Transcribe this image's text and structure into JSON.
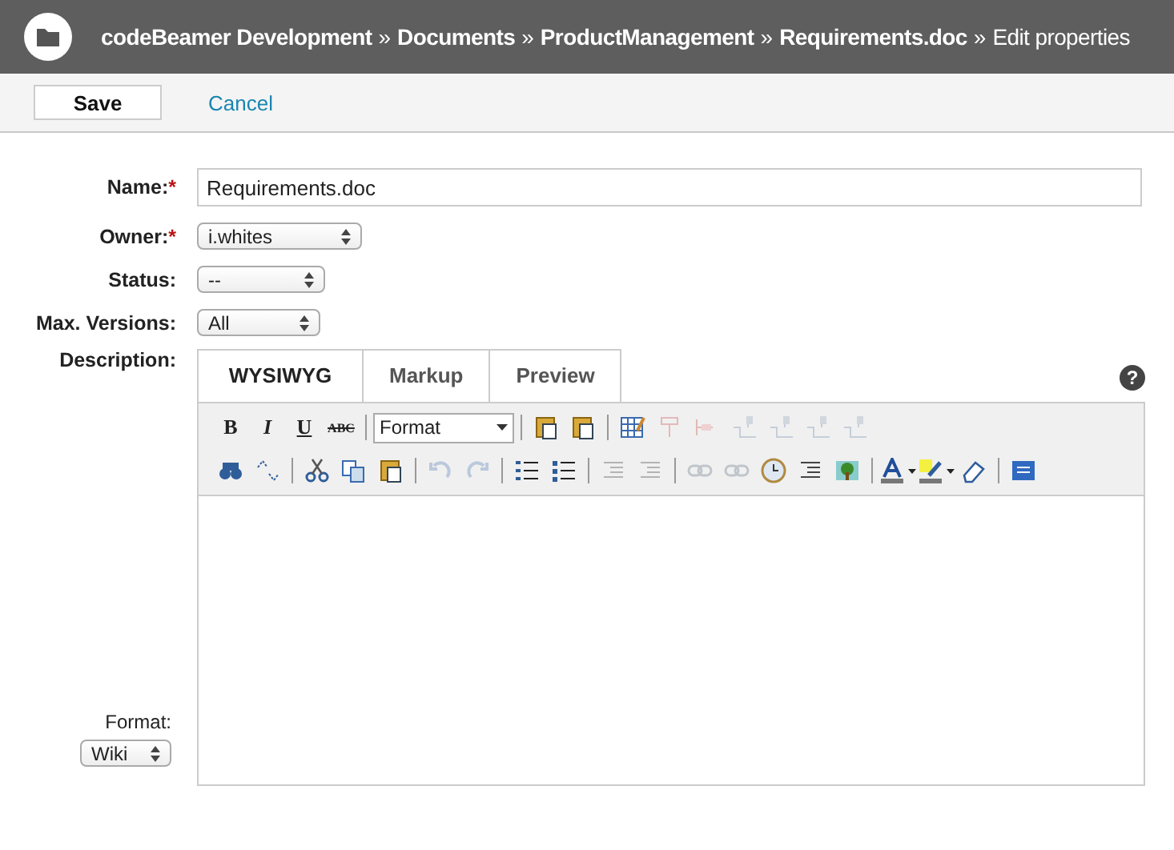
{
  "header": {
    "breadcrumbs": [
      {
        "label": "codeBeamer Development",
        "kind": "link"
      },
      {
        "label": "»",
        "kind": "sep"
      },
      {
        "label": "Documents",
        "kind": "link"
      },
      {
        "label": "»",
        "kind": "sep"
      },
      {
        "label": "ProductManagement",
        "kind": "link"
      },
      {
        "label": "»",
        "kind": "sep"
      },
      {
        "label": "Requirements.doc",
        "kind": "link"
      },
      {
        "label": "»",
        "kind": "sep"
      },
      {
        "label": "Edit properties",
        "kind": "current"
      }
    ]
  },
  "actions": {
    "save": "Save",
    "cancel": "Cancel"
  },
  "form": {
    "fields": [
      {
        "label": "Name:",
        "required_mark": "*",
        "kind": "text",
        "value": "Requirements.doc"
      },
      {
        "label": "Owner:",
        "required_mark": "*",
        "kind": "select",
        "value": "i.whites"
      },
      {
        "label": "Status:",
        "kind": "select",
        "value": "--"
      },
      {
        "label": "Max. Versions:",
        "kind": "select",
        "value": "All"
      }
    ],
    "description_label": "Description:",
    "format_label": "Format:",
    "format_value": "Wiki"
  },
  "editor": {
    "tabs": [
      {
        "label": "WYSIWYG",
        "selected": true
      },
      {
        "label": "Markup",
        "selected": false
      },
      {
        "label": "Preview",
        "selected": false
      }
    ],
    "help": "?",
    "toolbar_rows": [
      [
        {
          "kind": "glyph",
          "label": "B"
        },
        {
          "kind": "glyph",
          "label": "I"
        },
        {
          "kind": "glyph",
          "label": "U"
        },
        {
          "kind": "glyph",
          "label": "ABC"
        },
        {
          "kind": "sep"
        },
        {
          "kind": "select",
          "label": "Format"
        },
        {
          "kind": "sep"
        },
        {
          "kind": "icon",
          "disabled": false
        },
        {
          "kind": "icon",
          "disabled": false
        },
        {
          "kind": "sep"
        },
        {
          "kind": "icon",
          "disabled": false
        },
        {
          "kind": "icon",
          "disabled": true
        },
        {
          "kind": "icon",
          "disabled": true
        },
        {
          "kind": "icon",
          "disabled": true
        },
        {
          "kind": "icon",
          "disabled": true
        },
        {
          "kind": "icon",
          "disabled": true
        },
        {
          "kind": "icon",
          "disabled": true
        }
      ],
      [
        {
          "kind": "icon",
          "disabled": false
        },
        {
          "kind": "icon",
          "disabled": false
        },
        {
          "kind": "sep"
        },
        {
          "kind": "icon",
          "disabled": false
        },
        {
          "kind": "icon",
          "disabled": false
        },
        {
          "kind": "icon",
          "disabled": false
        },
        {
          "kind": "sep"
        },
        {
          "kind": "icon",
          "disabled": true
        },
        {
          "kind": "icon",
          "disabled": true
        },
        {
          "kind": "sep"
        },
        {
          "kind": "icon",
          "disabled": false
        },
        {
          "kind": "icon",
          "disabled": false
        },
        {
          "kind": "sep"
        },
        {
          "kind": "icon",
          "disabled": true
        },
        {
          "kind": "icon",
          "disabled": true
        },
        {
          "kind": "sep"
        },
        {
          "kind": "icon",
          "disabled": true
        },
        {
          "kind": "icon",
          "disabled": true
        },
        {
          "kind": "icon",
          "disabled": false
        },
        {
          "kind": "icon",
          "disabled": false
        },
        {
          "kind": "icon",
          "disabled": false
        },
        {
          "kind": "sep"
        },
        {
          "kind": "icon",
          "disabled": false,
          "dropdown": true
        },
        {
          "kind": "icon",
          "disabled": false,
          "dropdown": true
        },
        {
          "kind": "icon",
          "disabled": false
        },
        {
          "kind": "sep"
        },
        {
          "kind": "icon",
          "disabled": false
        }
      ]
    ]
  }
}
